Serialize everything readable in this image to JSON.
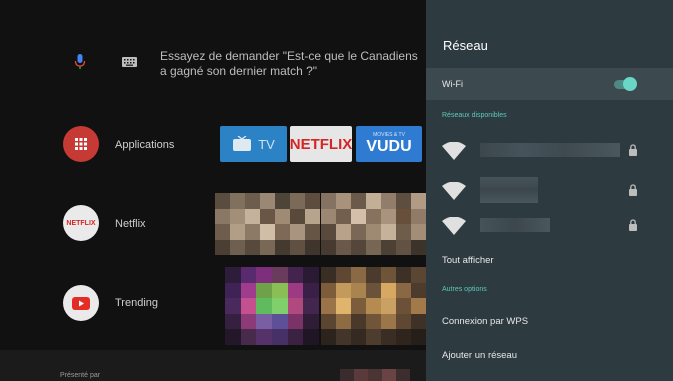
{
  "search": {
    "prompt": "Essayez de demander \"Est-ce que le Canadiens a gagné son dernier match ?\""
  },
  "rows": [
    {
      "label": "Applications"
    },
    {
      "label": "Netflix"
    },
    {
      "label": "Trending"
    }
  ],
  "apps": {
    "tv_label": "TV",
    "netflix_label": "NETFLIX",
    "vudu_label": "VUDU",
    "vudu_sub": "MOVIES & TV"
  },
  "netflix_icon_label": "NETFLIX",
  "footer": {
    "label": "Présenté par"
  },
  "panel": {
    "title": "Réseau",
    "wifi_label": "Wi-Fi",
    "wifi_on": true,
    "available_label": "Réseaux disponibles",
    "show_all": "Tout afficher",
    "other_label": "Autres options",
    "wps": "Connexion par WPS",
    "add_network": "Ajouter un réseau"
  },
  "colors": {
    "panel_bg": "#2d3a40",
    "accent": "#5ec9b8",
    "apps_red": "#c53a34",
    "youtube_red": "#e52d27",
    "tile_blue": "#2b83c6"
  }
}
